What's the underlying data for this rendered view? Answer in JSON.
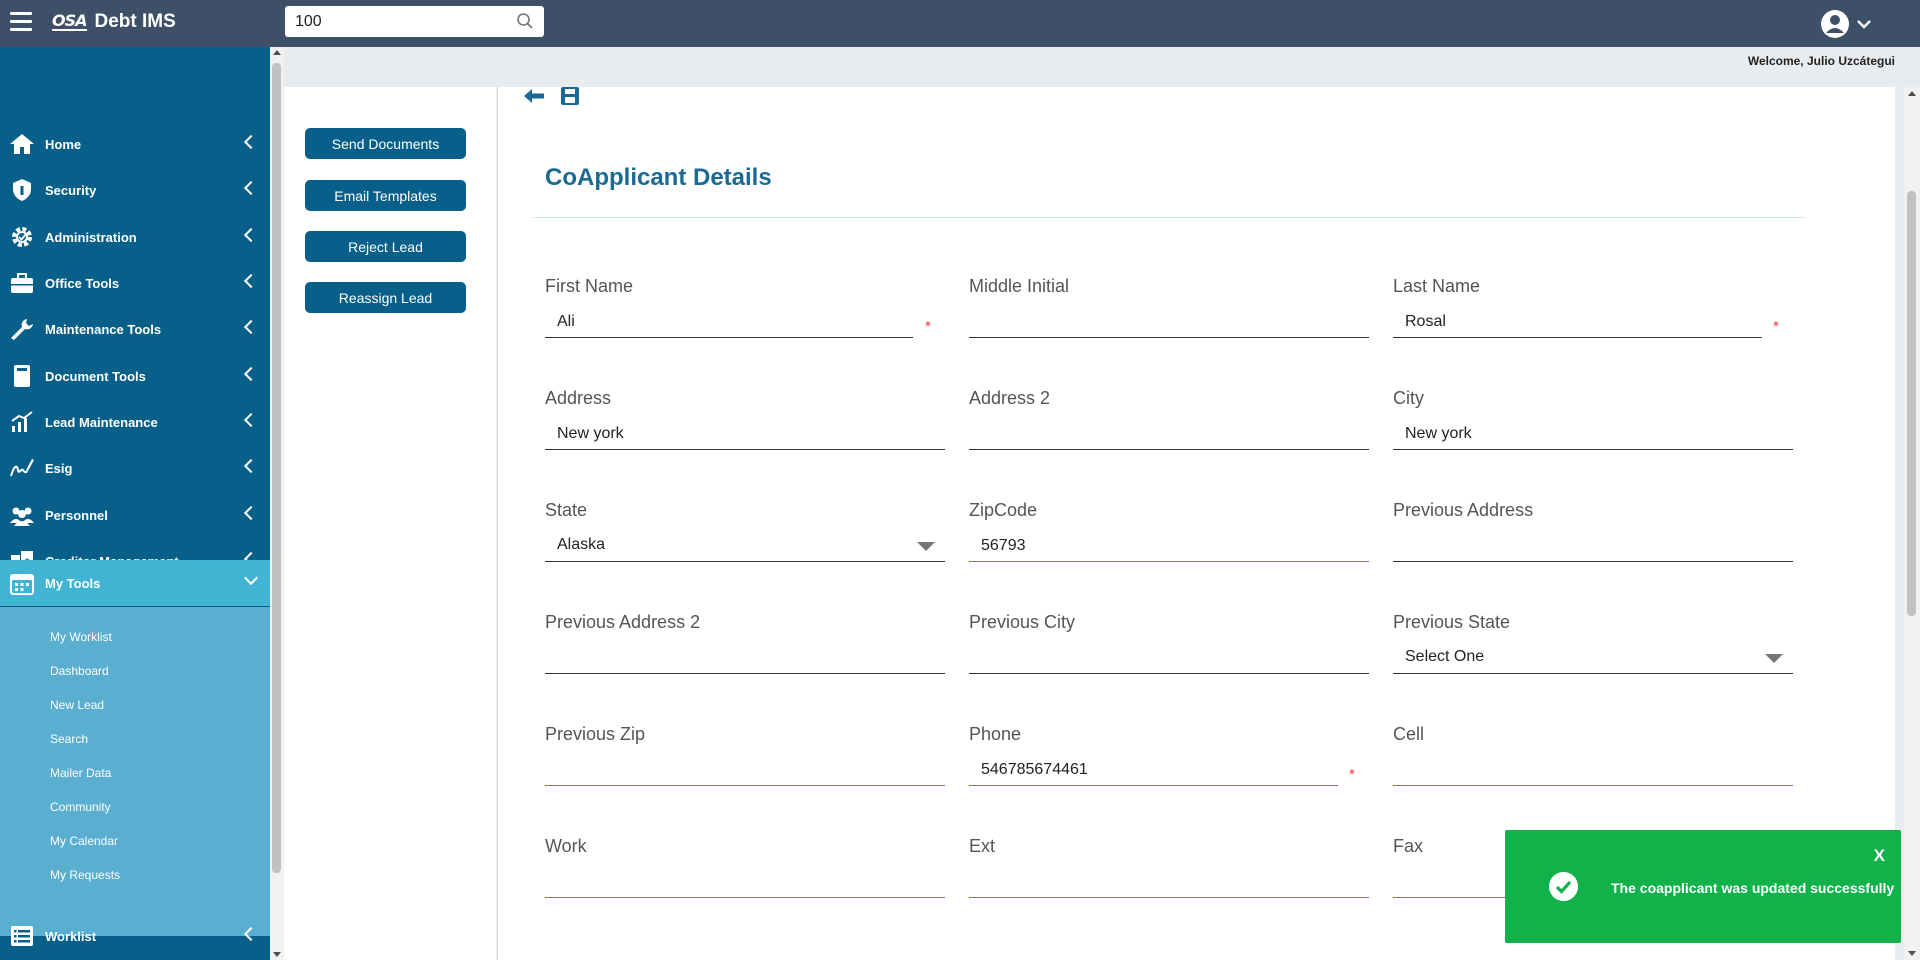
{
  "brand": {
    "logo_text": "OSA",
    "name": "Debt IMS"
  },
  "search": {
    "value": "100"
  },
  "user": {
    "welcome": "Welcome, Julio Uzcátegui"
  },
  "sidebar": {
    "items": [
      {
        "label": "Home"
      },
      {
        "label": "Security"
      },
      {
        "label": "Administration"
      },
      {
        "label": "Office Tools"
      },
      {
        "label": "Maintenance Tools"
      },
      {
        "label": "Document Tools"
      },
      {
        "label": "Lead Maintenance"
      },
      {
        "label": "Esig"
      },
      {
        "label": "Personnel"
      },
      {
        "label": "Creditor Management"
      },
      {
        "label": "My Tools"
      },
      {
        "label": "Worklist"
      }
    ],
    "my_tools_sub": [
      "My Worklist",
      "Dashboard",
      "New Lead",
      "Search",
      "Mailer Data",
      "Community",
      "My Calendar",
      "My Requests"
    ]
  },
  "actions": {
    "send_documents": "Send Documents",
    "email_templates": "Email Templates",
    "reject_lead": "Reject Lead",
    "reassign_lead": "Reassign Lead"
  },
  "form": {
    "title": "CoApplicant Details",
    "first_name": {
      "label": "First Name",
      "value": "Ali"
    },
    "middle_initial": {
      "label": "Middle Initial",
      "value": ""
    },
    "last_name": {
      "label": "Last Name",
      "value": "Rosal"
    },
    "address": {
      "label": "Address",
      "value": "New york"
    },
    "address2": {
      "label": "Address 2",
      "value": ""
    },
    "city": {
      "label": "City",
      "value": "New york"
    },
    "state": {
      "label": "State",
      "value": "Alaska"
    },
    "zipcode": {
      "label": "ZipCode",
      "value": "56793"
    },
    "previous_address": {
      "label": "Previous Address",
      "value": ""
    },
    "previous_address2": {
      "label": "Previous Address 2",
      "value": ""
    },
    "previous_city": {
      "label": "Previous City",
      "value": ""
    },
    "previous_state": {
      "label": "Previous State",
      "value": "Select One"
    },
    "previous_zip": {
      "label": "Previous Zip",
      "value": ""
    },
    "phone": {
      "label": "Phone",
      "value": "546785674461"
    },
    "cell": {
      "label": "Cell",
      "value": ""
    },
    "work": {
      "label": "Work",
      "value": ""
    },
    "ext": {
      "label": "Ext",
      "value": ""
    },
    "fax": {
      "label": "Fax",
      "value": ""
    },
    "required_mark": "*"
  },
  "toast": {
    "message": "The coapplicant was updated successfully",
    "close": "X"
  },
  "colors": {
    "topbar": "#3e5068",
    "sidebar": "#075f8a",
    "active": "#41b3d3",
    "submenu": "#5aaed0",
    "title": "#1a6a94",
    "toast": "#12b24b"
  }
}
